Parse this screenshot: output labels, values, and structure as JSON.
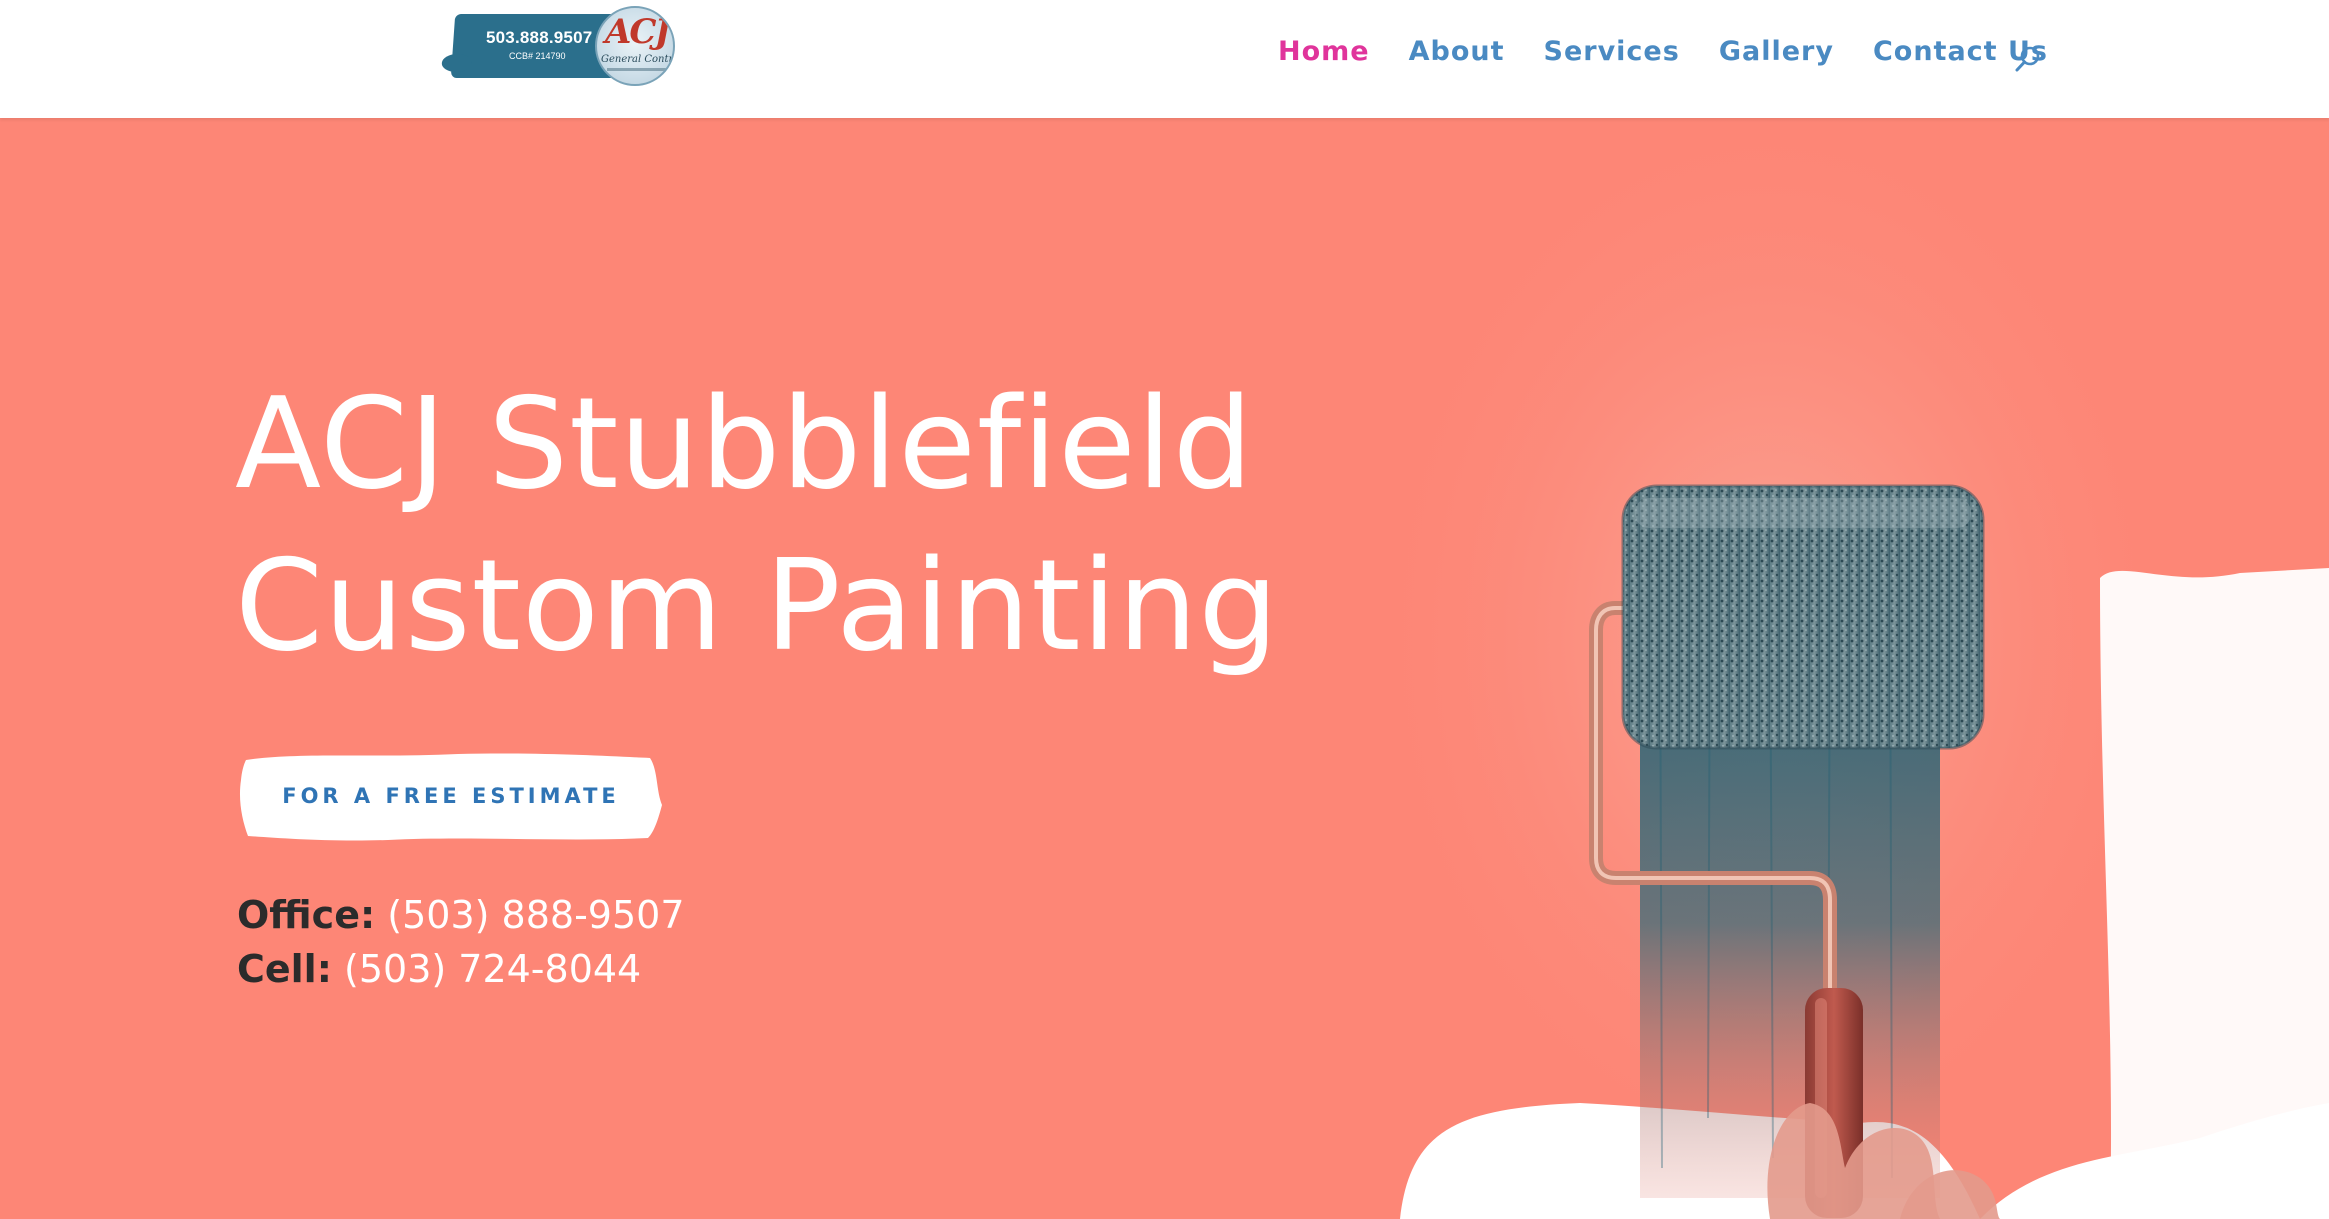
{
  "header": {
    "logo": {
      "phone": "503.888.9507",
      "ccb": "CCB# 214790",
      "mark": "ACJ",
      "subtitle": "General Contractor"
    },
    "nav": {
      "items": [
        {
          "label": "Home",
          "active": true
        },
        {
          "label": "About",
          "active": false
        },
        {
          "label": "Services",
          "active": false
        },
        {
          "label": "Gallery",
          "active": false
        },
        {
          "label": "Contact Us",
          "active": false
        }
      ],
      "search_icon": "search-icon"
    }
  },
  "hero": {
    "title_line1": "ACJ Stubblefield",
    "title_line2": "Custom Painting",
    "cta_label": "FOR A FREE ESTIMATE",
    "office_label": "Office:",
    "office_phone": "(503) 888-9507",
    "cell_label": "Cell:",
    "cell_phone": "(503) 724-8044"
  },
  "colors": {
    "hero_background": "#fd8676",
    "nav_link": "#4a8ac2",
    "nav_active": "#e0349b",
    "cta_text": "#2f74b5",
    "logo_band": "#2b6f8c"
  }
}
